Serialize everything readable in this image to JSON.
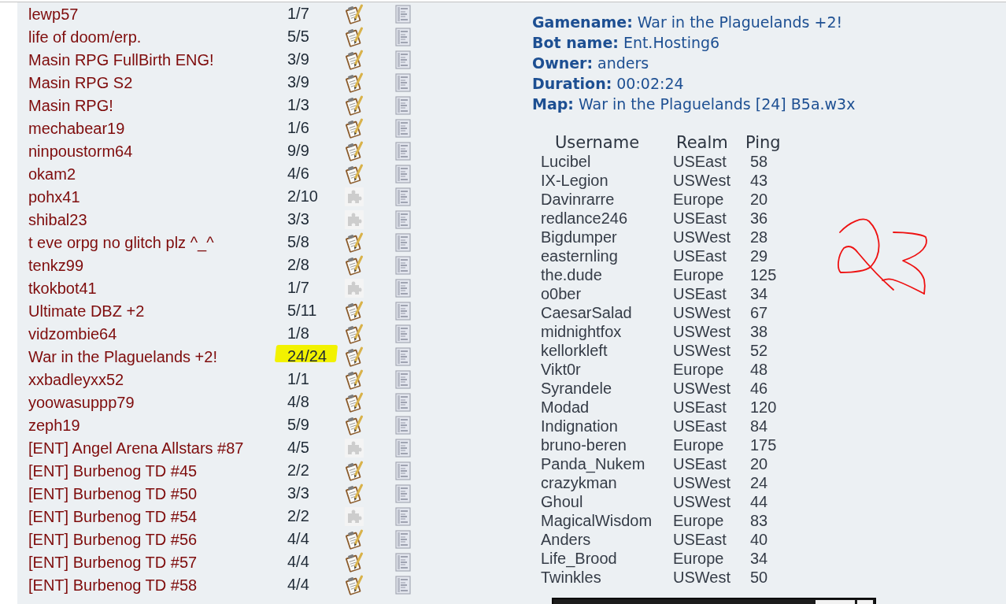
{
  "game_list": {
    "rows": [
      {
        "name": "lewp57",
        "players": "1/7",
        "kind": "clipboard",
        "highlighted": false
      },
      {
        "name": "life of doom/erp.",
        "players": "5/5",
        "kind": "clipboard",
        "highlighted": false
      },
      {
        "name": "Masin RPG FullBirth ENG!",
        "players": "3/9",
        "kind": "clipboard",
        "highlighted": false
      },
      {
        "name": "Masin RPG S2",
        "players": "3/9",
        "kind": "clipboard",
        "highlighted": false
      },
      {
        "name": "Masin RPG!",
        "players": "1/3",
        "kind": "clipboard",
        "highlighted": false
      },
      {
        "name": "mechabear19",
        "players": "1/6",
        "kind": "clipboard",
        "highlighted": false
      },
      {
        "name": "ninpoustorm64",
        "players": "9/9",
        "kind": "clipboard",
        "highlighted": false
      },
      {
        "name": "okam2",
        "players": "4/6",
        "kind": "clipboard",
        "highlighted": false
      },
      {
        "name": "pohx41",
        "players": "2/10",
        "kind": "puzzle",
        "highlighted": false
      },
      {
        "name": "shibal23",
        "players": "3/3",
        "kind": "puzzle",
        "highlighted": false
      },
      {
        "name": "t eve orpg no glitch plz ^_^",
        "players": "5/8",
        "kind": "clipboard",
        "highlighted": false
      },
      {
        "name": "tenkz99",
        "players": "2/8",
        "kind": "clipboard",
        "highlighted": false
      },
      {
        "name": "tkokbot41",
        "players": "1/7",
        "kind": "puzzle",
        "highlighted": false
      },
      {
        "name": "Ultimate DBZ +2",
        "players": "5/11",
        "kind": "clipboard",
        "highlighted": false
      },
      {
        "name": "vidzombie64",
        "players": "1/8",
        "kind": "clipboard",
        "highlighted": false
      },
      {
        "name": "War in the Plaguelands +2!",
        "players": "24/24",
        "kind": "clipboard",
        "highlighted": true
      },
      {
        "name": "xxbadleyxx52",
        "players": "1/1",
        "kind": "clipboard",
        "highlighted": false
      },
      {
        "name": "yoowasuppp79",
        "players": "4/8",
        "kind": "clipboard",
        "highlighted": false
      },
      {
        "name": "zeph19",
        "players": "5/9",
        "kind": "clipboard",
        "highlighted": false
      },
      {
        "name": "[ENT] Angel Arena Allstars #87",
        "players": "4/5",
        "kind": "puzzle",
        "highlighted": false
      },
      {
        "name": "[ENT] Burbenog TD #45",
        "players": "2/2",
        "kind": "clipboard",
        "highlighted": false
      },
      {
        "name": "[ENT] Burbenog TD #50",
        "players": "3/3",
        "kind": "clipboard",
        "highlighted": false
      },
      {
        "name": "[ENT] Burbenog TD #54",
        "players": "2/2",
        "kind": "puzzle",
        "highlighted": false
      },
      {
        "name": "[ENT] Burbenog TD #56",
        "players": "4/4",
        "kind": "clipboard",
        "highlighted": false
      },
      {
        "name": "[ENT] Burbenog TD #57",
        "players": "4/4",
        "kind": "clipboard",
        "highlighted": false
      },
      {
        "name": "[ENT] Burbenog TD #58",
        "players": "4/4",
        "kind": "clipboard",
        "highlighted": false
      }
    ]
  },
  "game_details": {
    "fields": [
      {
        "label": "Gamename:",
        "value": "War in the Plaguelands +2!"
      },
      {
        "label": "Bot name:",
        "value": "Ent.Hosting6"
      },
      {
        "label": "Owner:",
        "value": "anders"
      },
      {
        "label": "Duration:",
        "value": "00:02:24"
      },
      {
        "label": "Map:",
        "value": "War in the Plaguelands [24] B5a.w3x"
      }
    ]
  },
  "players_table": {
    "columns": [
      "Username",
      "Realm",
      "Ping"
    ],
    "rows": [
      {
        "username": "Lucibel",
        "realm": "USEast",
        "ping": "58"
      },
      {
        "username": "IX-Legion",
        "realm": "USWest",
        "ping": "43"
      },
      {
        "username": "Davinrarre",
        "realm": "Europe",
        "ping": "20"
      },
      {
        "username": "redlance246",
        "realm": "USEast",
        "ping": "36"
      },
      {
        "username": "Bigdumper",
        "realm": "USWest",
        "ping": "28"
      },
      {
        "username": "easternling",
        "realm": "USEast",
        "ping": "29"
      },
      {
        "username": "the.dude",
        "realm": "Europe",
        "ping": "125"
      },
      {
        "username": "o0ber",
        "realm": "USEast",
        "ping": "34"
      },
      {
        "username": "CaesarSalad",
        "realm": "USWest",
        "ping": "67"
      },
      {
        "username": "midnightfox",
        "realm": "USWest",
        "ping": "38"
      },
      {
        "username": "kellorkleft",
        "realm": "USWest",
        "ping": "52"
      },
      {
        "username": "Vikt0r",
        "realm": "Europe",
        "ping": "48"
      },
      {
        "username": "Syrandele",
        "realm": "USWest",
        "ping": "46"
      },
      {
        "username": "Modad",
        "realm": "USEast",
        "ping": "120"
      },
      {
        "username": "Indignation",
        "realm": "USEast",
        "ping": "84"
      },
      {
        "username": "bruno-beren",
        "realm": "Europe",
        "ping": "175"
      },
      {
        "username": "Panda_Nukem",
        "realm": "USEast",
        "ping": "20"
      },
      {
        "username": "crazykman",
        "realm": "USWest",
        "ping": "24"
      },
      {
        "username": "Ghoul",
        "realm": "USWest",
        "ping": "44"
      },
      {
        "username": "MagicalWisdom",
        "realm": "Europe",
        "ping": "83"
      },
      {
        "username": "Anders",
        "realm": "USEast",
        "ping": "40"
      },
      {
        "username": "Life_Brood",
        "realm": "Europe",
        "ping": "34"
      },
      {
        "username": "Twinkles",
        "realm": "USWest",
        "ping": "50"
      }
    ]
  }
}
